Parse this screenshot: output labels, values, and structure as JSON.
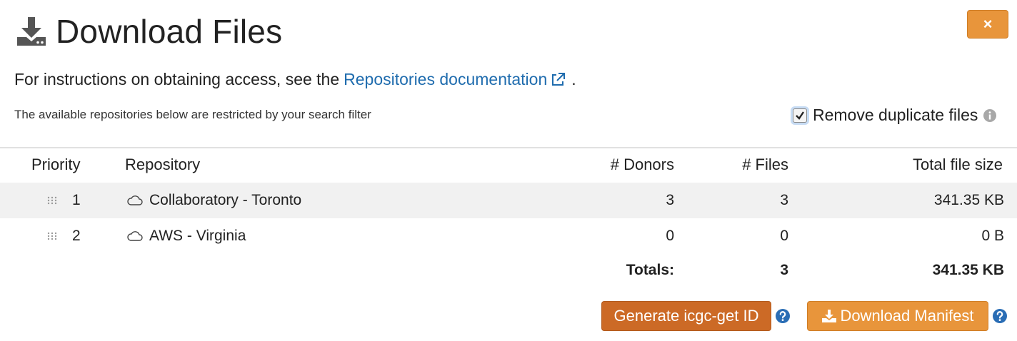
{
  "dialog": {
    "title": "Download Files",
    "close_label": "×",
    "title_icon": "download-icon"
  },
  "instructions": {
    "prefix": "For instructions on obtaining access, see the",
    "link_text": "Repositories documentation",
    "suffix": "."
  },
  "restriction_note": "The available repositories below are restricted by your search filter",
  "remove_duplicates": {
    "label": "Remove duplicate files",
    "checked": true
  },
  "table": {
    "headers": {
      "priority": "Priority",
      "repository": "Repository",
      "donors": "# Donors",
      "files": "# Files",
      "size": "Total file size"
    },
    "rows": [
      {
        "priority": "1",
        "repository": "Collaboratory - Toronto",
        "donors": "3",
        "files": "3",
        "size": "341.35 KB"
      },
      {
        "priority": "2",
        "repository": "AWS - Virginia",
        "donors": "0",
        "files": "0",
        "size": "0 B"
      }
    ],
    "totals": {
      "label": "Totals:",
      "files": "3",
      "size": "341.35 KB"
    }
  },
  "buttons": {
    "generate_label": "Generate icgc-get ID",
    "manifest_label": "Download Manifest"
  },
  "colors": {
    "accent_orange": "#e8953b",
    "dark_orange": "#cc6a26",
    "link_blue": "#1f6cae",
    "help_blue": "#2a6db5"
  }
}
